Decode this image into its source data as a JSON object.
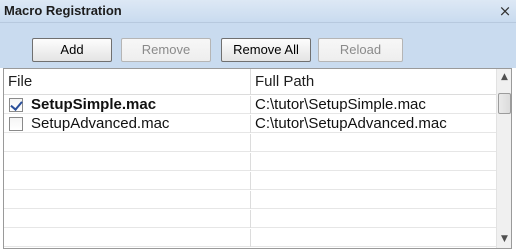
{
  "window": {
    "title": "Macro Registration",
    "close_glyph": "×"
  },
  "toolbar": {
    "add_label": "Add",
    "remove_label": "Remove",
    "remove_all_label": "Remove All",
    "reload_label": "Reload",
    "remove_enabled": false,
    "reload_enabled": false
  },
  "table": {
    "columns": [
      "File",
      "Full Path"
    ],
    "rows": [
      {
        "file": "SetupSimple.mac",
        "path": "C:\\tutor\\SetupSimple.mac",
        "checked": true
      },
      {
        "file": "SetupAdvanced.mac",
        "path": "C:\\tutor\\SetupAdvanced.mac",
        "checked": false
      }
    ]
  },
  "scrollbar": {
    "up_glyph": "▲",
    "down_glyph": "▼"
  },
  "colors": {
    "title_bg": "#dde8f5",
    "toolbar_bg": "#c9dbef",
    "checkmark": "#2a4f9a"
  }
}
